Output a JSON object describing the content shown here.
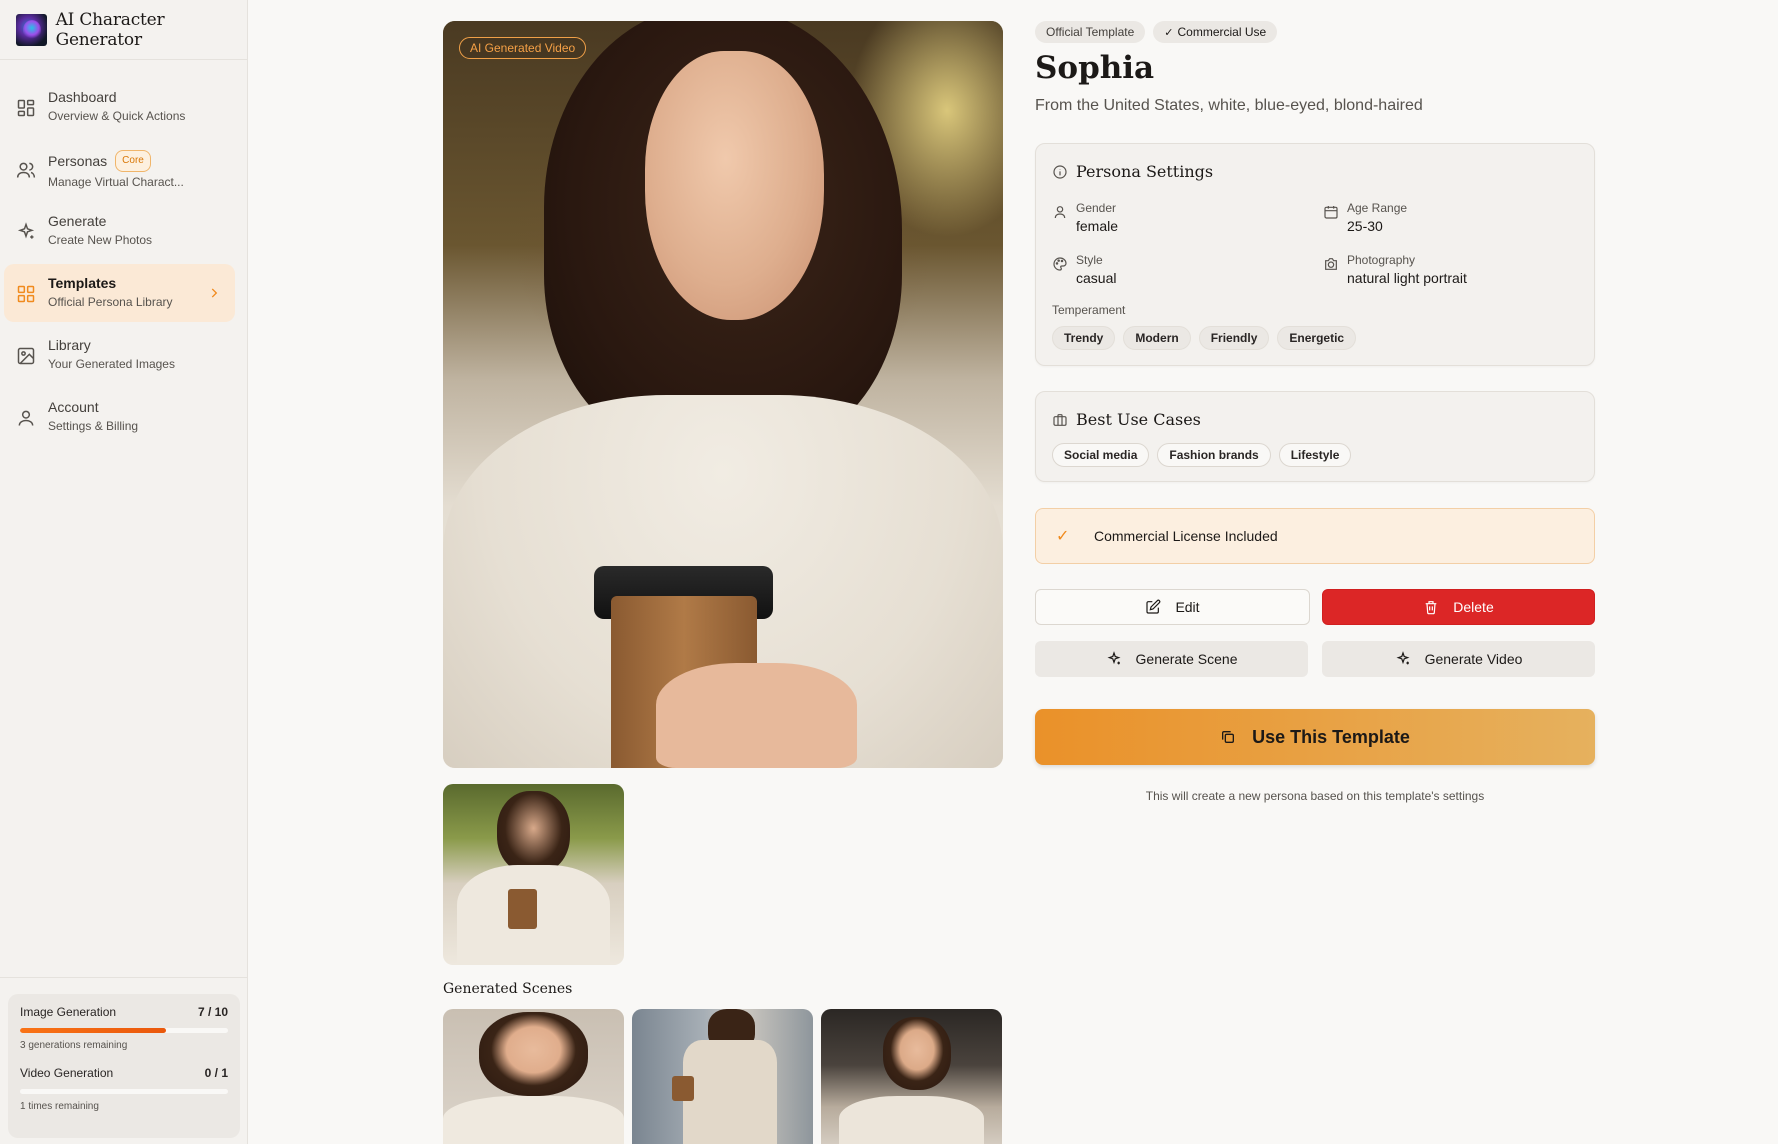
{
  "app": {
    "title": "AI Character Generator"
  },
  "sidebar": {
    "items": [
      {
        "label": "Dashboard",
        "sub": "Overview & Quick Actions",
        "icon": "grid-icon",
        "active": false
      },
      {
        "label": "Personas",
        "sub": "Manage Virtual Charact...",
        "icon": "users-icon",
        "badge": "Core",
        "active": false
      },
      {
        "label": "Generate",
        "sub": "Create New Photos",
        "icon": "sparkle-icon",
        "active": false
      },
      {
        "label": "Templates",
        "sub": "Official Persona Library",
        "icon": "template-grid-icon",
        "active": true
      },
      {
        "label": "Library",
        "sub": "Your Generated Images",
        "icon": "image-icon",
        "active": false
      },
      {
        "label": "Account",
        "sub": "Settings & Billing",
        "icon": "user-icon",
        "active": false
      }
    ],
    "usage": {
      "image": {
        "label": "Image Generation",
        "count": "7 / 10",
        "used": 7,
        "total": 10,
        "note": "3 generations remaining"
      },
      "video": {
        "label": "Video Generation",
        "count": "0 / 1",
        "used": 0,
        "total": 1,
        "note": "1 times remaining"
      }
    }
  },
  "main": {
    "badge": "AI Generated Video",
    "generated_scenes_title": "Generated Scenes"
  },
  "persona": {
    "tags": {
      "official": "Official Template",
      "commercial": "Commercial Use"
    },
    "name": "Sophia",
    "description": "From the United States, white, blue-eyed, blond-haired",
    "settings": {
      "title": "Persona Settings",
      "gender_label": "Gender",
      "gender": "female",
      "age_label": "Age Range",
      "age": "25-30",
      "style_label": "Style",
      "style": "casual",
      "photography_label": "Photography",
      "photography": "natural light portrait",
      "temperament_label": "Temperament",
      "temperament": [
        "Trendy",
        "Modern",
        "Friendly",
        "Energetic"
      ]
    },
    "use_cases": {
      "title": "Best Use Cases",
      "items": [
        "Social media",
        "Fashion brands",
        "Lifestyle"
      ]
    },
    "license": "Commercial License Included",
    "actions": {
      "edit": "Edit",
      "delete": "Delete",
      "generate_scene": "Generate Scene",
      "generate_video": "Generate Video",
      "use_template": "Use This Template",
      "hint": "This will create a new persona based on this template's settings"
    }
  },
  "colors": {
    "accent": "#f08a1d",
    "danger": "#dc2626",
    "active_bg": "#fbe9d6"
  }
}
